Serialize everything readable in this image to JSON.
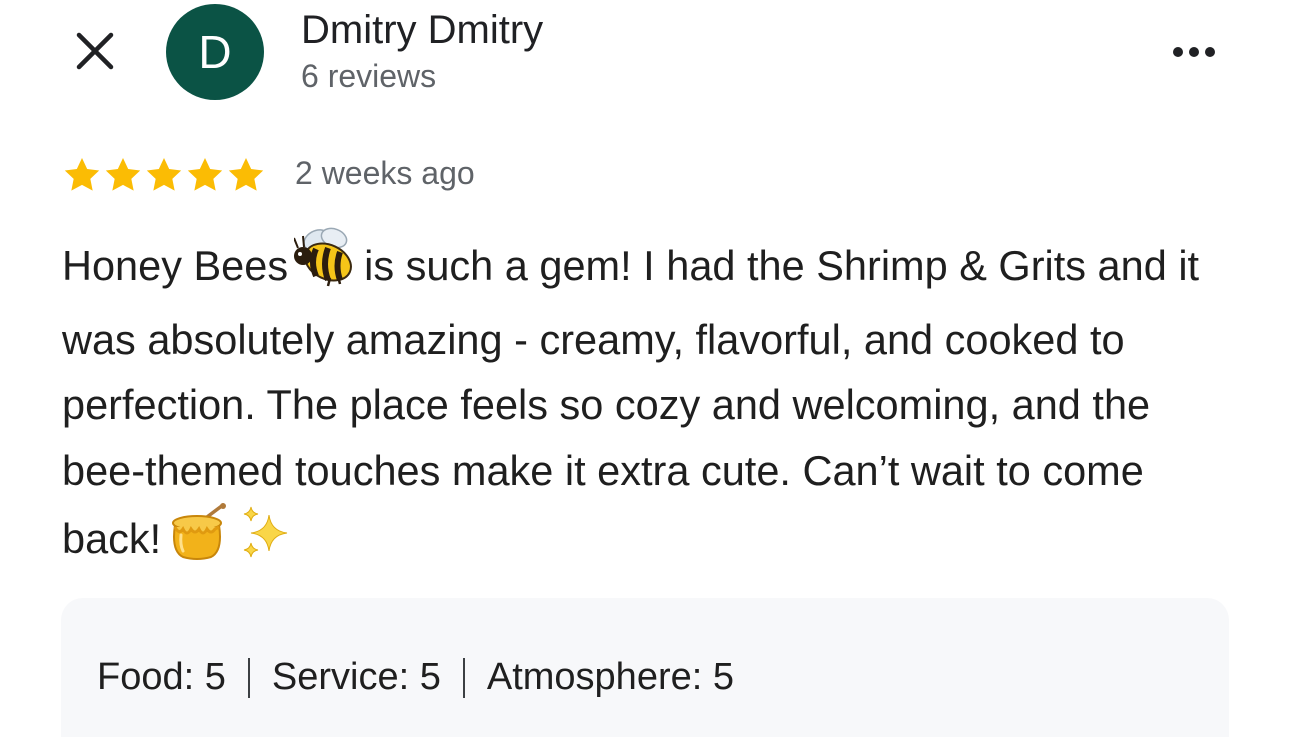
{
  "header": {
    "close_icon": "close-icon",
    "avatar_initial": "D",
    "avatar_color": "#0b5345",
    "user_name": "Dmitry Dmitry",
    "review_count": "6 reviews",
    "more_icon": "more-horizontal-icon"
  },
  "review": {
    "rating": 5,
    "rating_max": 5,
    "star_color": "#fbbc04",
    "time_ago": "2 weeks ago",
    "text_part1": "Honey Bees",
    "text_part2": "is such a gem! I had the Shrimp & Grits and it was absolutely amazing - creamy, flavorful, and cooked to perfection. The place feels so cozy and welcoming, and the bee-themed touches make it extra cute. Can’t wait to come back!",
    "emojis": [
      "bee-emoji",
      "honey-pot-emoji",
      "sparkles-emoji"
    ]
  },
  "ratings": {
    "food_label": "Food:",
    "food_value": "5",
    "service_label": "Service:",
    "service_value": "5",
    "atmosphere_label": "Atmosphere:",
    "atmosphere_value": "5"
  }
}
